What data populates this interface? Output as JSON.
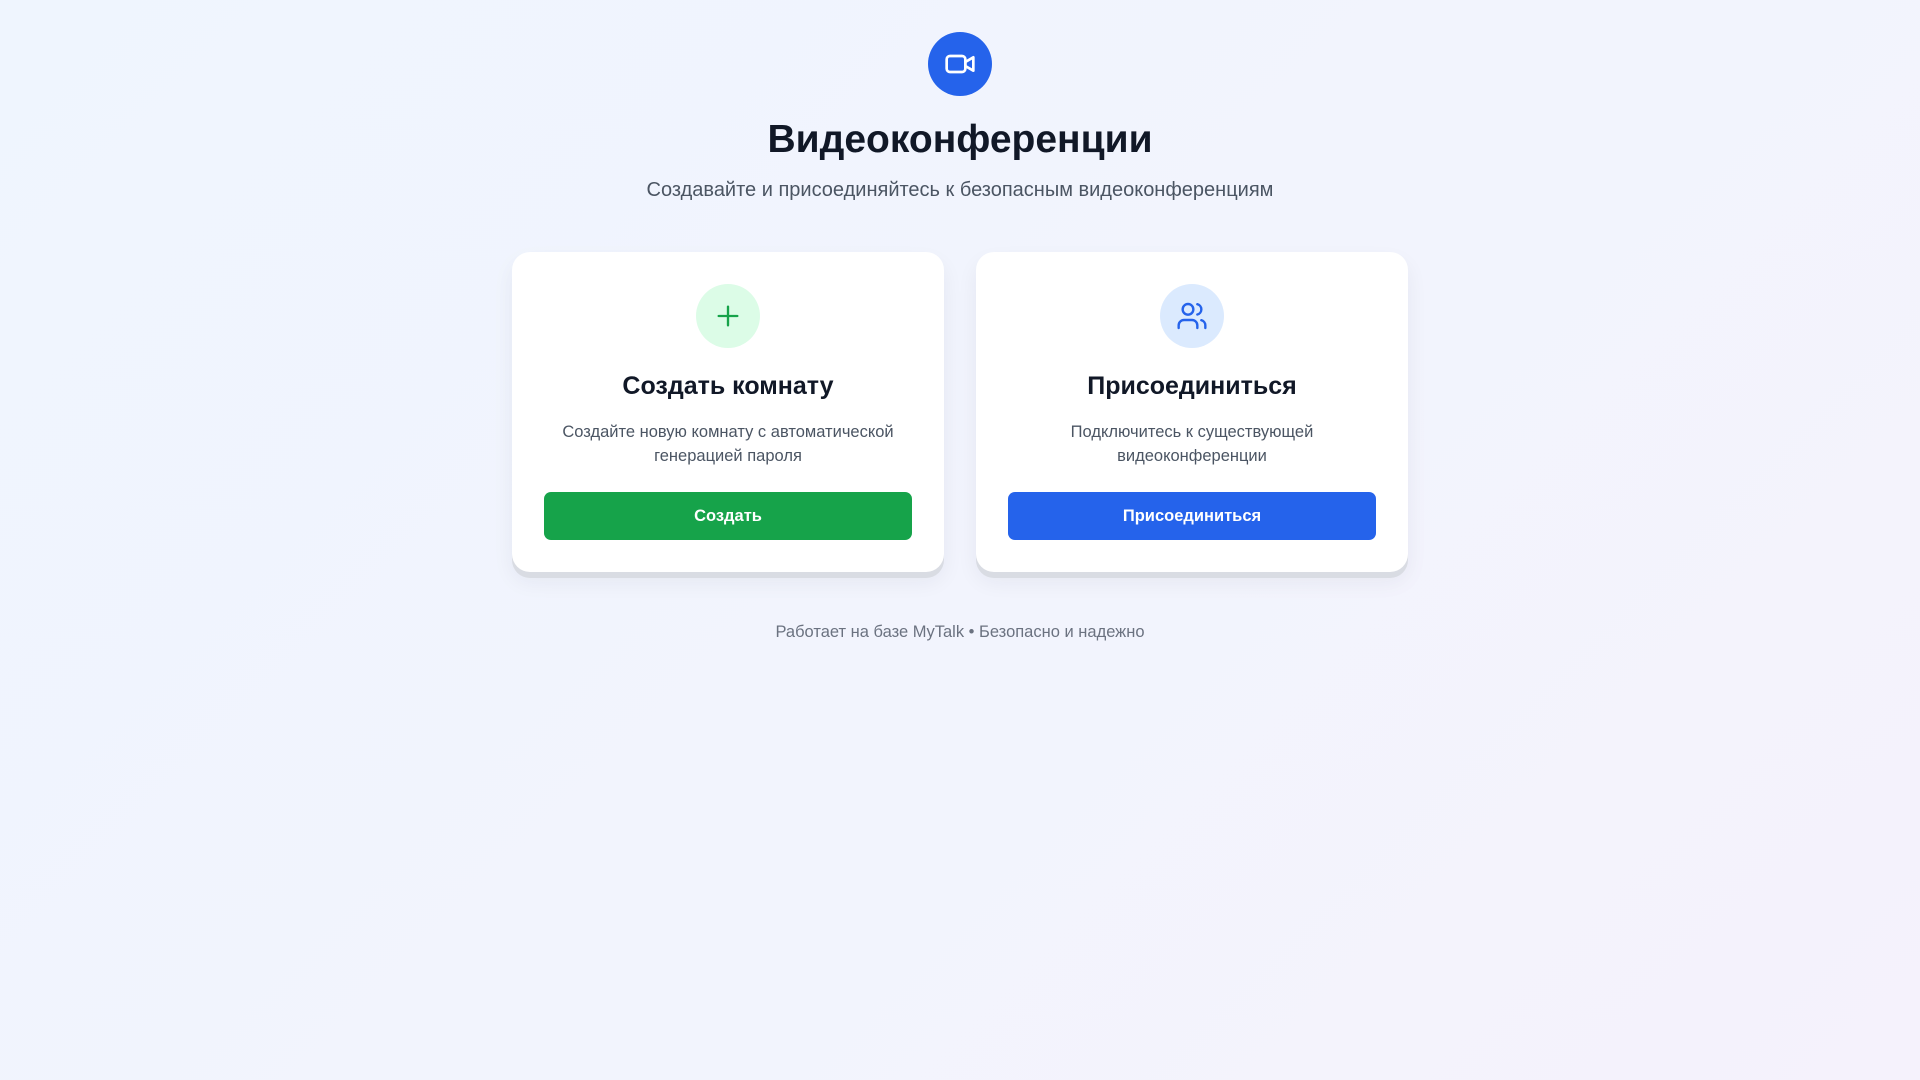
{
  "header": {
    "logo_icon": "video-camera-icon",
    "title": "Видеоконференции",
    "subtitle": "Создавайте и присоединяйтесь к безопасным видеоконференциям"
  },
  "cards": {
    "create": {
      "icon": "plus-icon",
      "title": "Создать комнату",
      "description": "Создайте новую комнату с автоматической генерацией пароля",
      "button_label": "Создать",
      "accent_color": "#16a34a"
    },
    "join": {
      "icon": "users-icon",
      "title": "Присоединиться",
      "description": "Подключитесь к существующей видеоконференции",
      "button_label": "Присоединиться",
      "accent_color": "#2563eb"
    }
  },
  "footer": {
    "text": "Работает на базе MyTalk • Безопасно и надежно"
  }
}
